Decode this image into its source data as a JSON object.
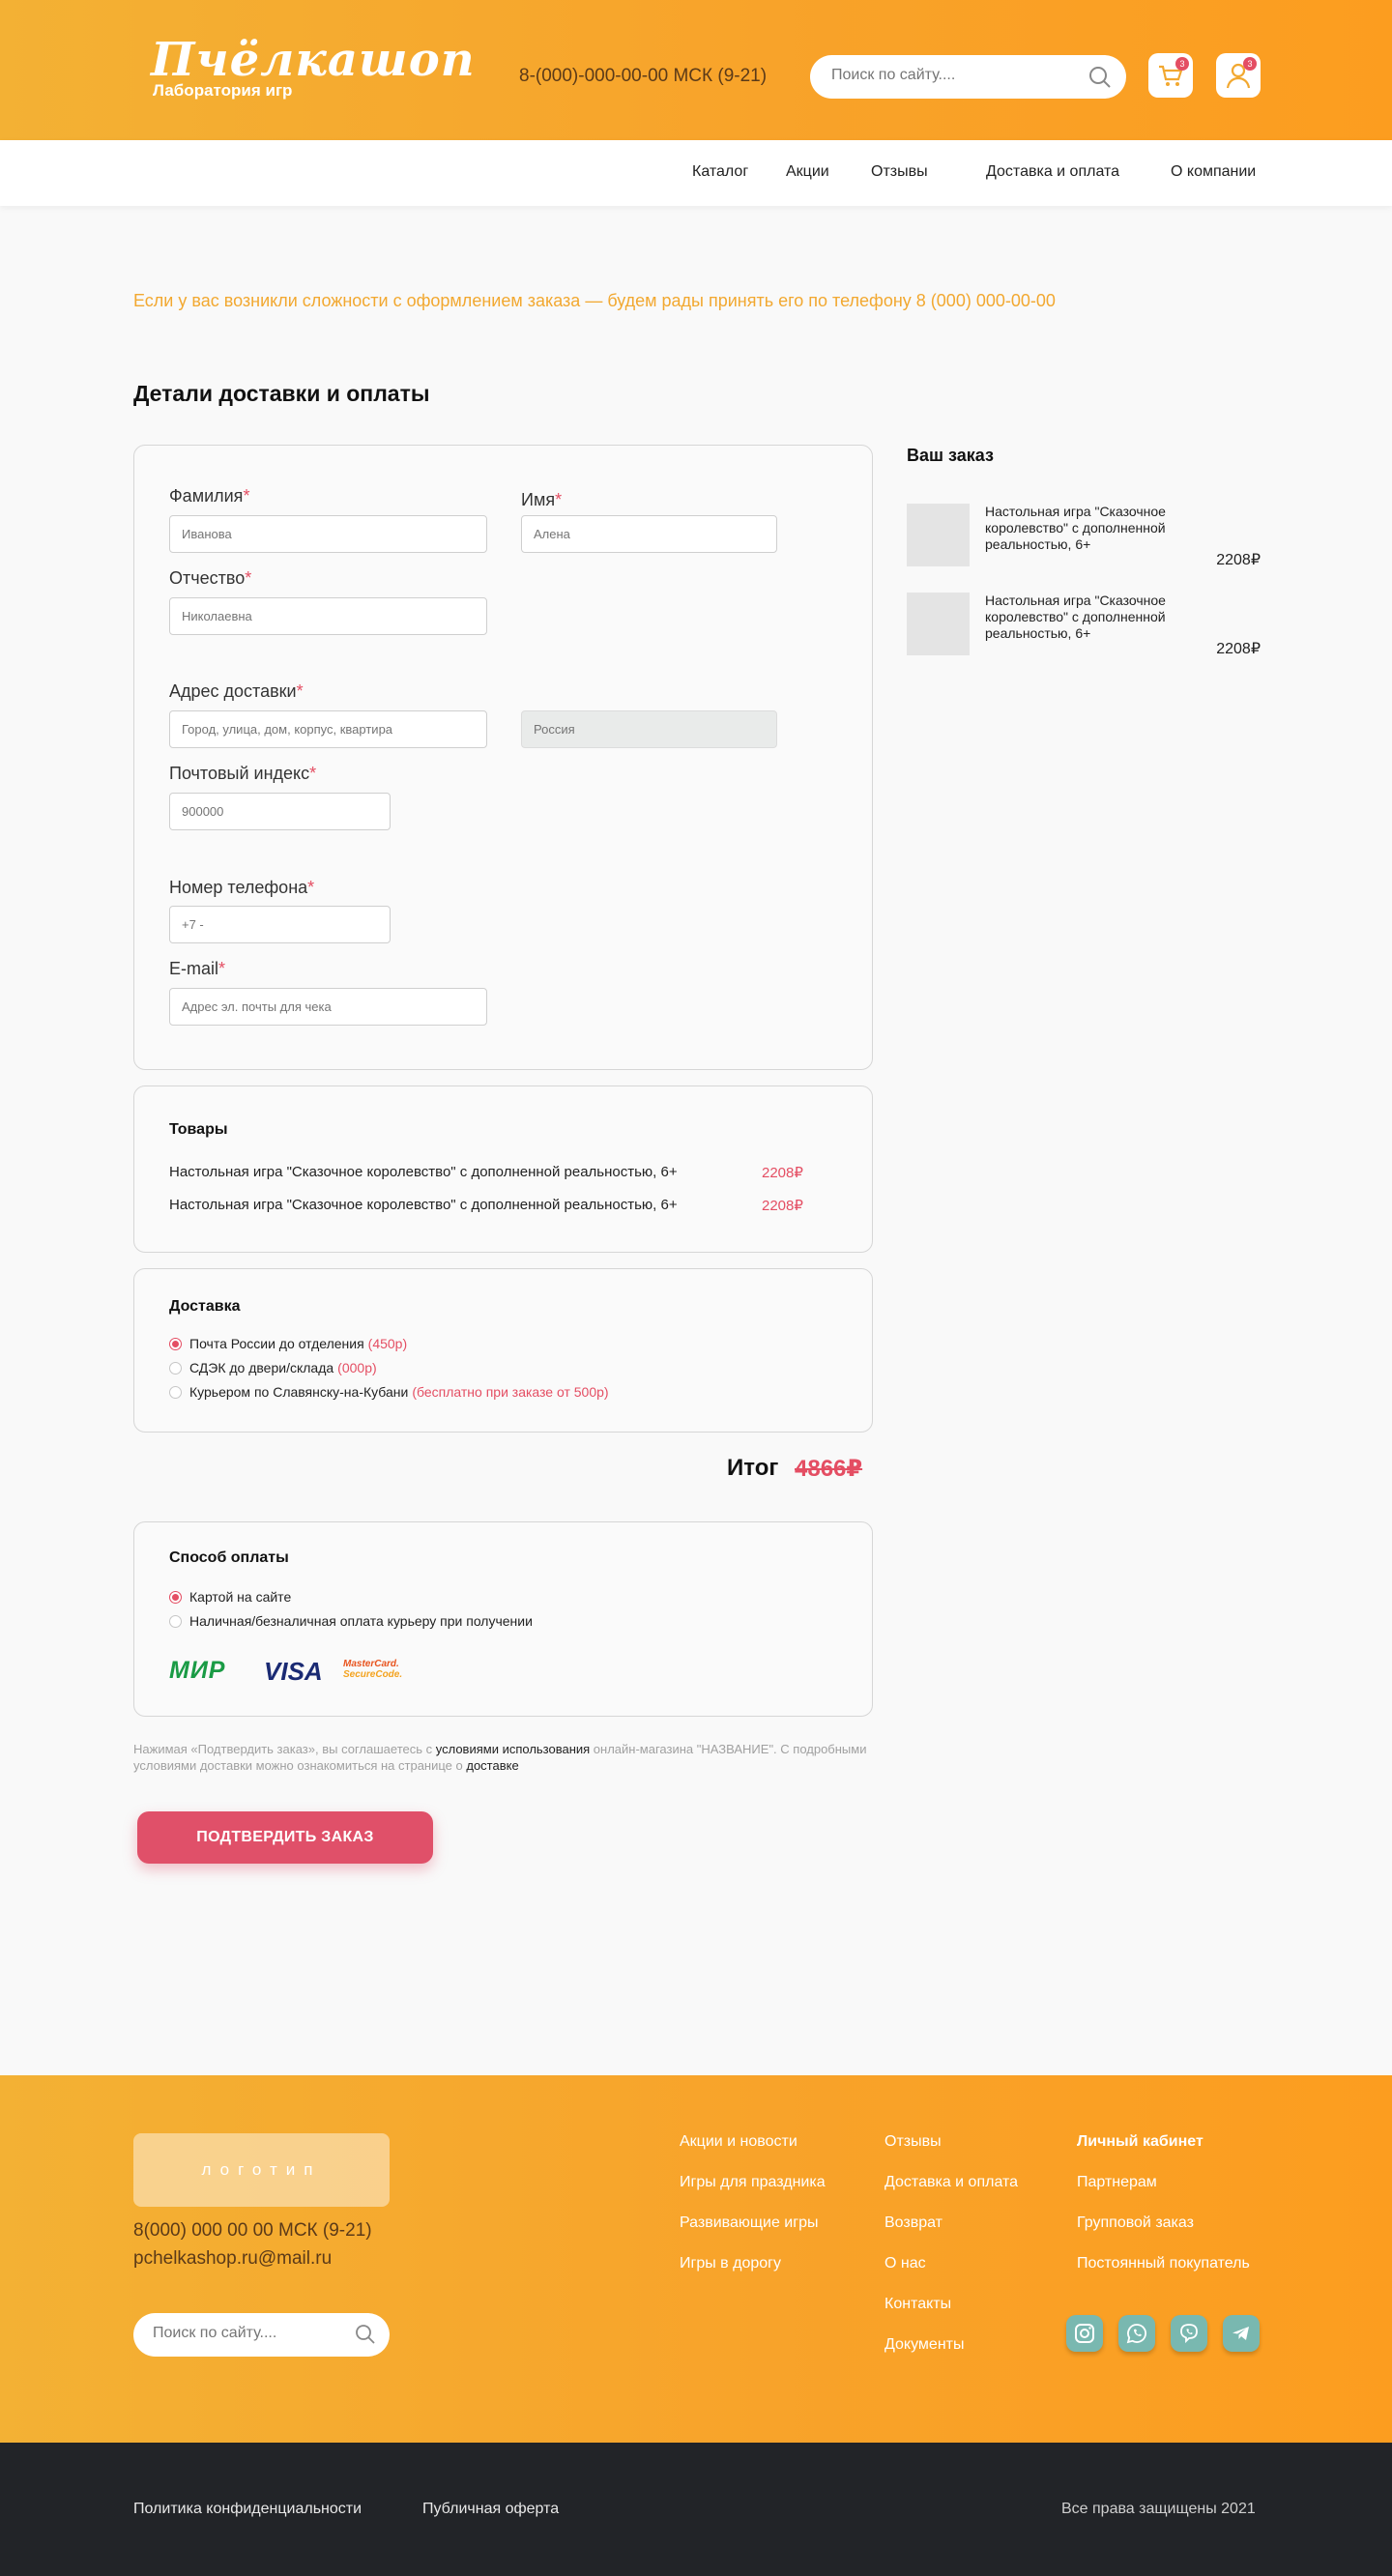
{
  "header": {
    "logo_main": "Пчёлкашоп",
    "logo_sub": "Лаборатория игр",
    "phone": "8-(000)-000-00-00 МСК (9-21)",
    "search_placeholder": "Поиск по сайту....",
    "cart_count": "3",
    "profile_count": "3"
  },
  "nav": {
    "items": [
      "Каталог",
      "Акции",
      "Отзывы",
      "Доставка и оплата",
      "О компании"
    ]
  },
  "notice": "Если у вас возникли сложности с оформлением заказа — будем рады принять его по телефону 8 (000) 000-00-00",
  "page_title": "Детали доставки и оплаты",
  "form": {
    "surname_label": "Фамилия",
    "surname_placeholder": "Иванова",
    "name_label": "Имя",
    "name_placeholder": "Алена",
    "patronymic_label": "Отчество",
    "patronymic_placeholder": "Николаевна",
    "address_label": "Адрес доставки",
    "address_placeholder": "Город, улица, дом, корпус, квартира",
    "country_value": "Россия",
    "zip_label": "Почтовый индекс",
    "zip_placeholder": "900000",
    "phone_label": "Номер телефона",
    "phone_placeholder": "+7 -",
    "email_label": "E-mail",
    "email_placeholder": "Адрес эл. почты для чека",
    "required_mark": "*"
  },
  "goods": {
    "title": "Товары",
    "items": [
      {
        "name": "Настольная игра \"Сказочное королевство\" с дополненной реальностью, 6+",
        "price": "2208₽"
      },
      {
        "name": "Настольная игра \"Сказочное королевство\" с дополненной реальностью, 6+",
        "price": "2208₽"
      }
    ]
  },
  "delivery": {
    "title": "Доставка",
    "options": [
      {
        "label": "Почта России до отделения",
        "note": "(450р)",
        "selected": true
      },
      {
        "label": "СДЭК до двери/склада",
        "note": "(000р)",
        "selected": false
      },
      {
        "label": "Курьером по Славянску-на-Кубани",
        "note": "(бесплатно при заказе от 500р)",
        "selected": false
      }
    ]
  },
  "total": {
    "label": "Итог",
    "value": "4866₽"
  },
  "payment": {
    "title": "Способ оплаты",
    "options": [
      {
        "label": "Картой на сайте",
        "selected": true
      },
      {
        "label": "Наличная/безналичная оплата курьеру при получении",
        "selected": false
      }
    ],
    "logos": {
      "mir": "МИР",
      "visa": "VISA",
      "mc_top": "MasterCard.",
      "mc_bottom": "SecureCode."
    }
  },
  "legal": {
    "part1": "Нажимая «Подтвердить заказ», вы соглашаетесь с ",
    "link1": "условиями использования",
    "part2": " онлайн-магазина \"НАЗВАНИЕ\". С подробными условиями доставки можно ознакомиться на странице о ",
    "link2": "доставке"
  },
  "confirm_button": "ПОДТВЕРДИТЬ ЗАКАЗ",
  "order": {
    "title": "Ваш заказ",
    "items": [
      {
        "name": "Настольная игра \"Сказочное королевство\" с дополненной реальностью, 6+",
        "price": "2208₽"
      },
      {
        "name": "Настольная игра \"Сказочное королевство\" с дополненной реальностью, 6+",
        "price": "2208₽"
      }
    ]
  },
  "footer": {
    "logo_placeholder": "логотип",
    "phone": "8(000) 000 00 00 МСК (9-21)",
    "email": "pchelkashop.ru@mail.ru",
    "search_placeholder": "Поиск по сайту....",
    "col1": [
      "Акции и новости",
      "Игры для праздника",
      "Развивающие игры",
      "Игры в дорогу"
    ],
    "col2": [
      "Отзывы",
      "Доставка и оплата",
      "Возврат",
      "О нас",
      "Контакты",
      "Документы"
    ],
    "col3": [
      "Личный кабинет",
      "Партнерам",
      "Групповой заказ",
      "Постоянный покупатель"
    ]
  },
  "bottom": {
    "privacy": "Политика конфиденциальности",
    "offer": "Публичная оферта",
    "rights": "Все права защищены 2021"
  },
  "colors": {
    "brand_orange": "#f8a32a",
    "accent_red": "#e05069",
    "footer_dark": "#222428",
    "social_teal": "#79b8b0"
  },
  "icons": [
    "search-icon",
    "cart-icon",
    "user-icon",
    "instagram-icon",
    "whatsapp-icon",
    "viber-icon",
    "telegram-icon"
  ]
}
